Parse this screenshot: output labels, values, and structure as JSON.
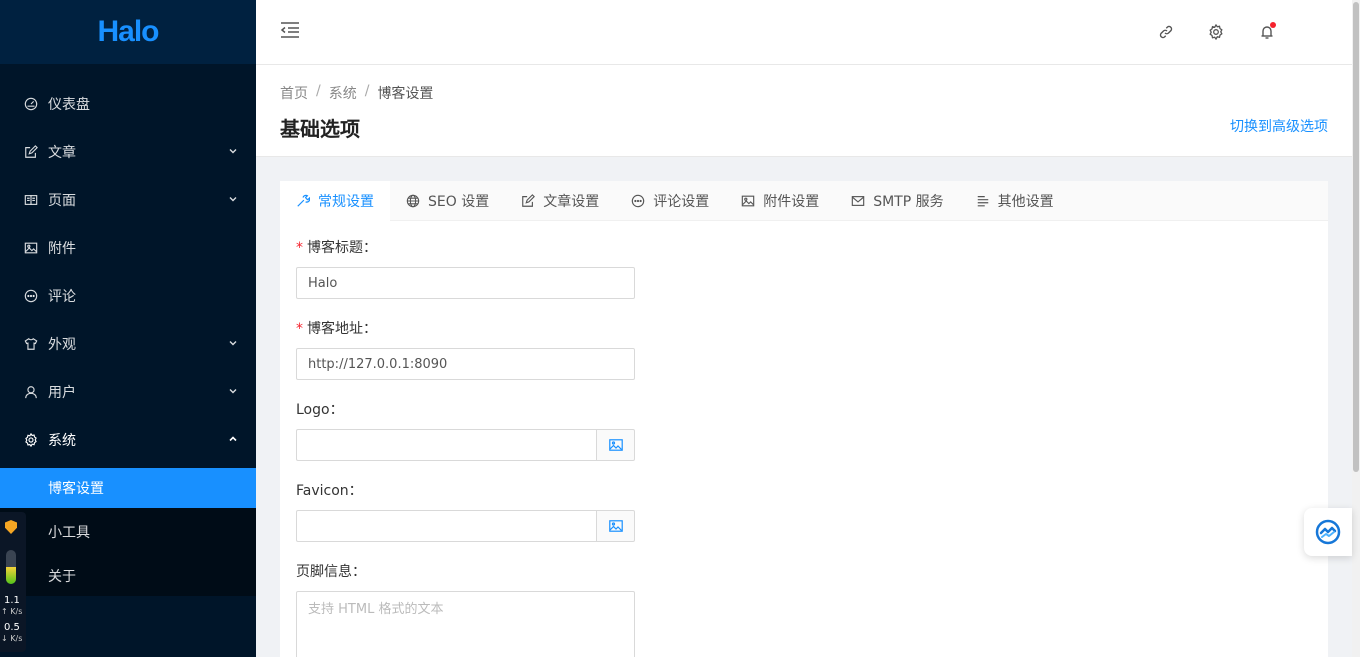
{
  "app": {
    "logo_text": "Halo"
  },
  "sidebar": {
    "items": [
      {
        "label": "仪表盘",
        "icon": "dashboard-icon"
      },
      {
        "label": "文章",
        "icon": "edit-icon",
        "arrow": "chevron-down-icon"
      },
      {
        "label": "页面",
        "icon": "read-icon",
        "arrow": "chevron-down-icon"
      },
      {
        "label": "附件",
        "icon": "picture-icon"
      },
      {
        "label": "评论",
        "icon": "message-icon"
      },
      {
        "label": "外观",
        "icon": "skin-icon",
        "arrow": "chevron-down-icon"
      },
      {
        "label": "用户",
        "icon": "user-icon",
        "arrow": "chevron-down-icon"
      },
      {
        "label": "系统",
        "icon": "setting-icon",
        "arrow": "chevron-up-icon"
      }
    ],
    "submenu": [
      {
        "label": "博客设置",
        "active": true
      },
      {
        "label": "小工具"
      },
      {
        "label": "关于"
      }
    ]
  },
  "monitor": {
    "badge": "1",
    "up_speed": "1.1",
    "up_unit": "↑ K/s",
    "down_speed": "0.5",
    "down_unit": "↓ K/s",
    "level": 0.5
  },
  "header": {
    "icons": [
      "menu-fold-icon",
      "link-icon",
      "setting-icon",
      "bell-icon"
    ]
  },
  "breadcrumb": [
    "首页",
    "系统",
    "博客设置"
  ],
  "page": {
    "title": "基础选项",
    "switch_link": "切换到高级选项"
  },
  "tabs": [
    {
      "label": "常规设置",
      "icon": "tool-icon",
      "active": true
    },
    {
      "label": "SEO 设置",
      "icon": "global-icon"
    },
    {
      "label": "文章设置",
      "icon": "form-icon"
    },
    {
      "label": "评论设置",
      "icon": "message-icon"
    },
    {
      "label": "附件设置",
      "icon": "picture-icon"
    },
    {
      "label": "SMTP 服务",
      "icon": "mail-icon"
    },
    {
      "label": "其他设置",
      "icon": "align-left-icon"
    }
  ],
  "form": {
    "blog_title": {
      "label": "博客标题：",
      "value": "Halo",
      "required": true
    },
    "blog_url": {
      "label": "博客地址：",
      "value": "http://127.0.0.1:8090",
      "required": true
    },
    "logo": {
      "label": "Logo：",
      "value": ""
    },
    "favicon": {
      "label": "Favicon：",
      "value": ""
    },
    "footer": {
      "label": "页脚信息：",
      "placeholder": "支持 HTML 格式的文本"
    }
  },
  "colors": {
    "primary": "#1890ff",
    "sidebar_bg": "#001529",
    "required": "#f5222d"
  }
}
